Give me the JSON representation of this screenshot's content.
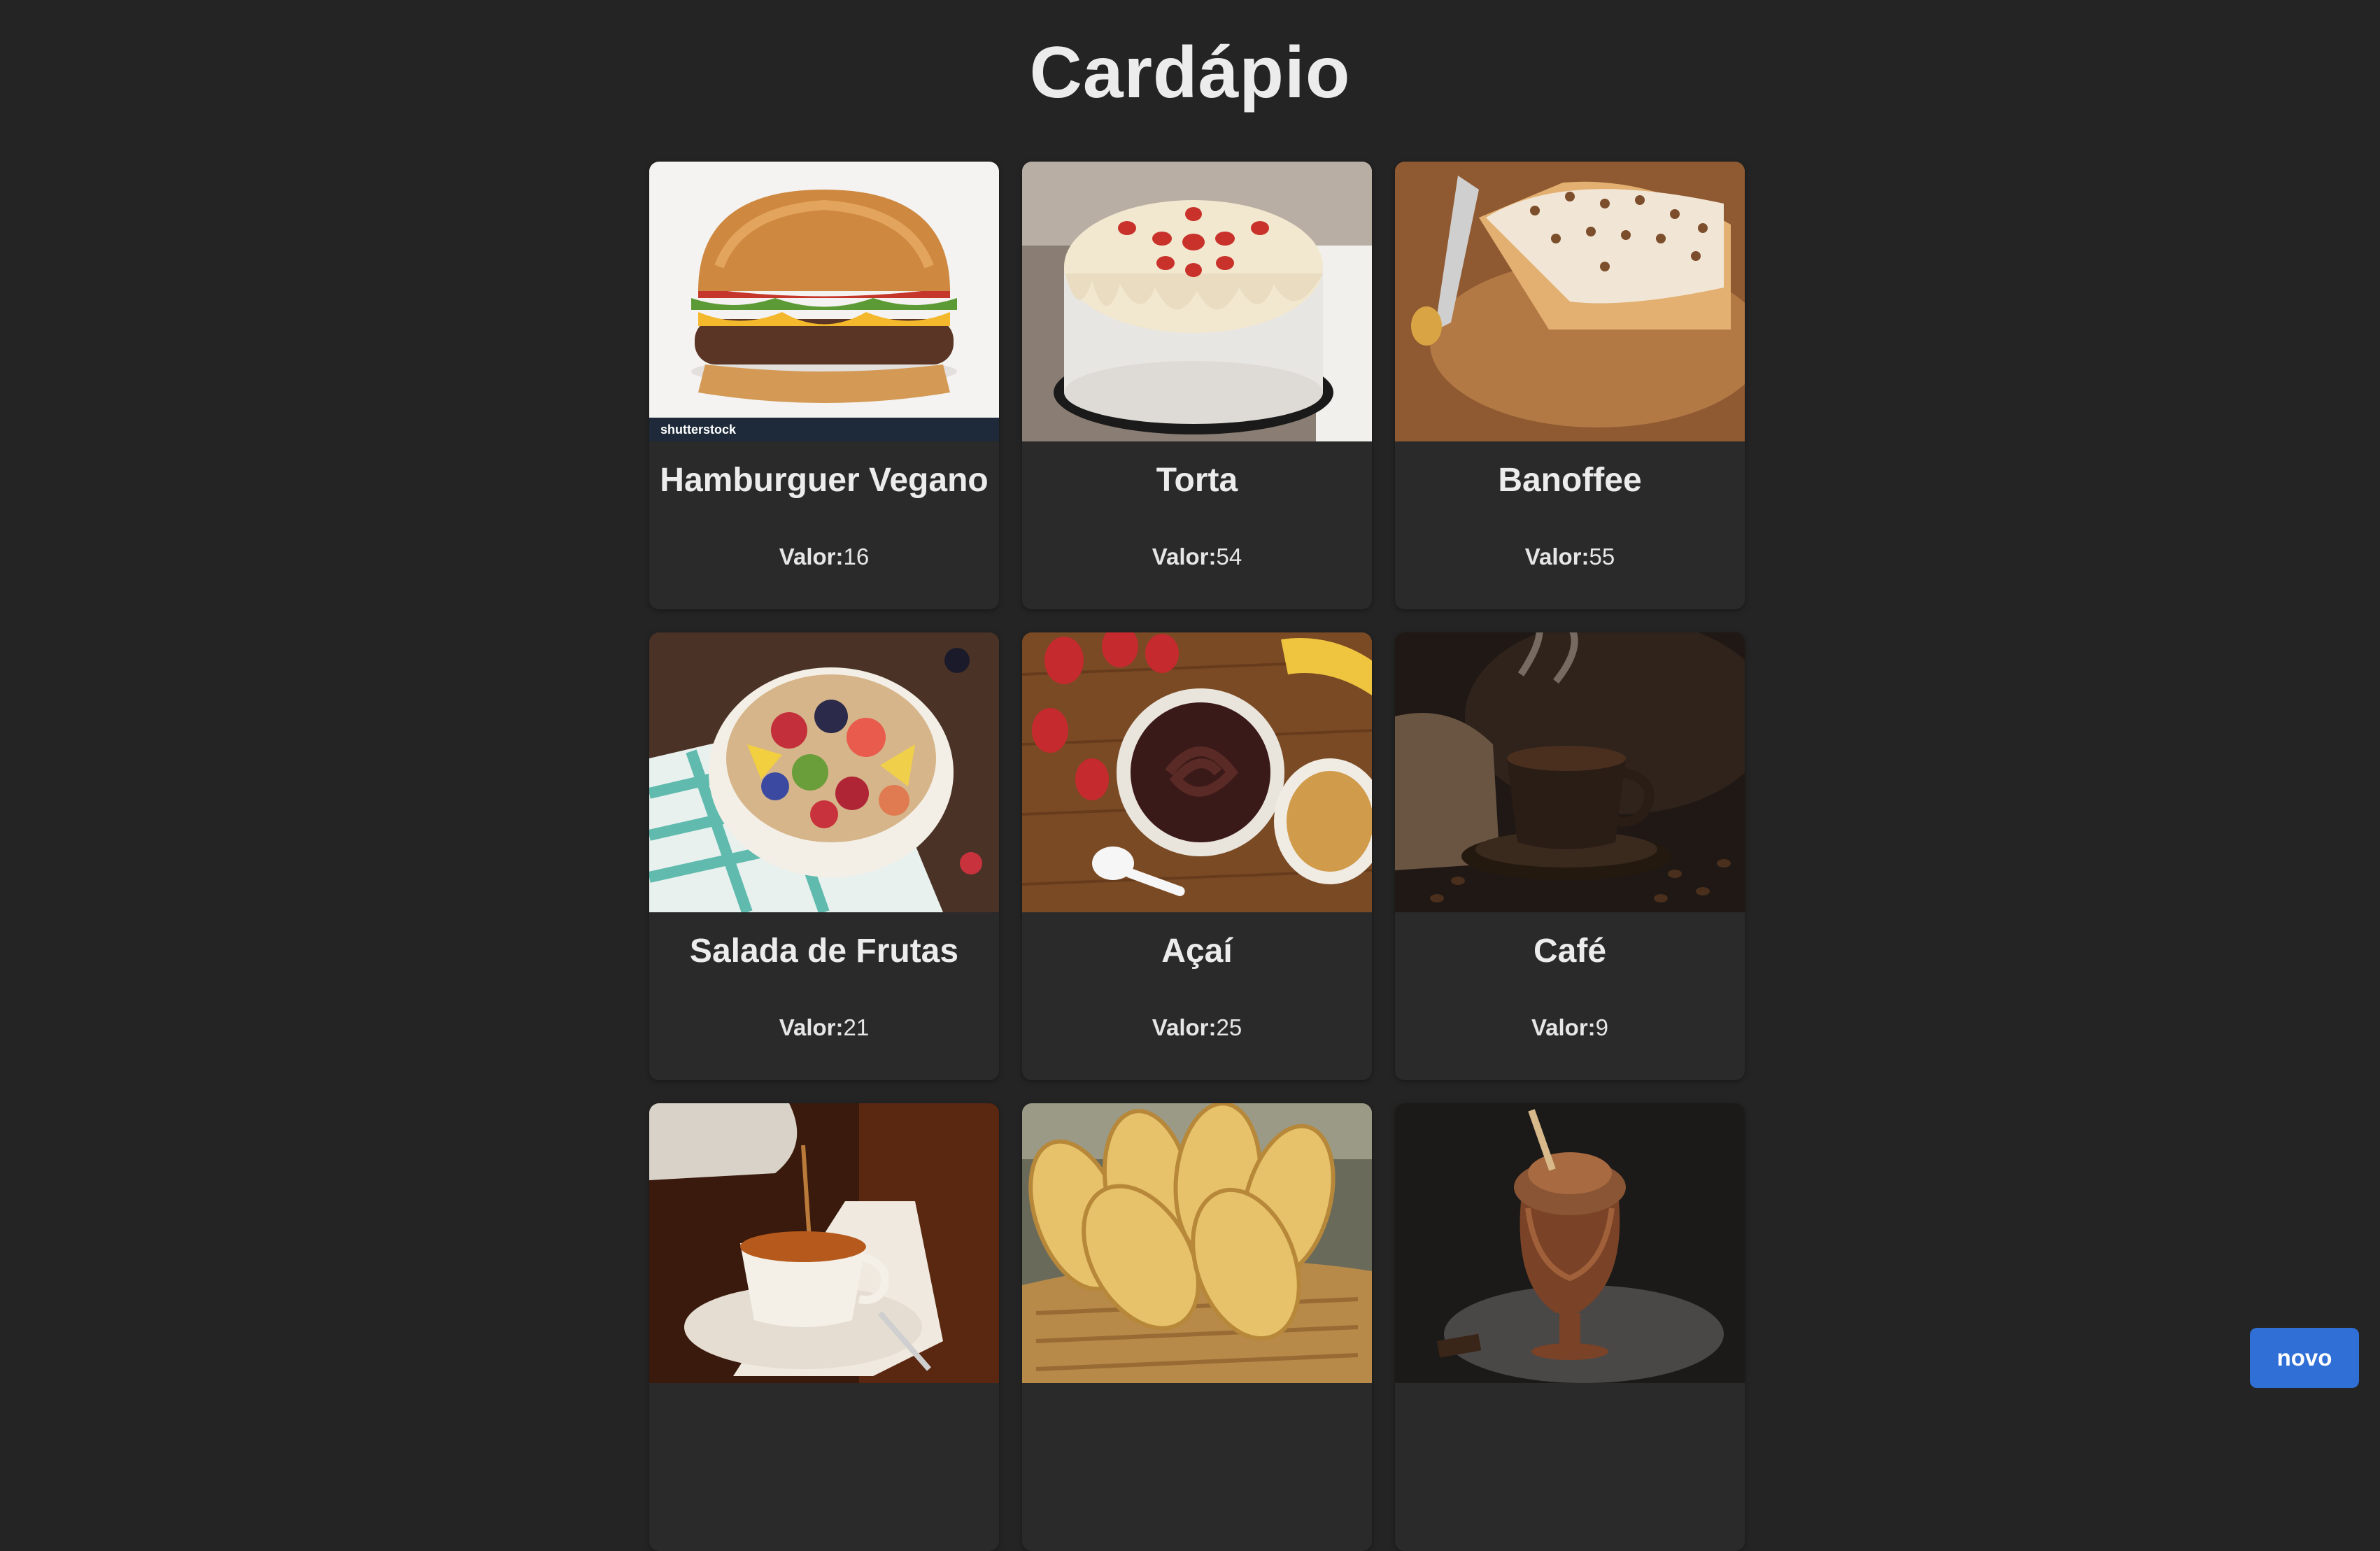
{
  "page": {
    "title": "Cardápio"
  },
  "menu": {
    "price_label": "Valor:",
    "items": [
      {
        "name": "Hamburguer Vegano",
        "price": "16",
        "icon": "burger-photo"
      },
      {
        "name": "Torta",
        "price": "54",
        "icon": "cake-photo"
      },
      {
        "name": "Banoffee",
        "price": "55",
        "icon": "banoffee-pie-photo"
      },
      {
        "name": "Salada de Frutas",
        "price": "21",
        "icon": "fruit-salad-photo"
      },
      {
        "name": "Açaí",
        "price": "25",
        "icon": "acai-bowl-photo"
      },
      {
        "name": "Café",
        "price": "9",
        "icon": "coffee-cup-photo"
      },
      {
        "name": "",
        "price": "",
        "icon": "tea-cup-photo"
      },
      {
        "name": "",
        "price": "",
        "icon": "garlic-bread-photo"
      },
      {
        "name": "",
        "price": "",
        "icon": "chocolate-drink-photo"
      }
    ]
  },
  "watermark": "shutterstock",
  "actions": {
    "new_label": "novo"
  },
  "colors": {
    "background": "#242424",
    "card": "#2a2a2a",
    "primary_button": "#2f6fd6"
  }
}
